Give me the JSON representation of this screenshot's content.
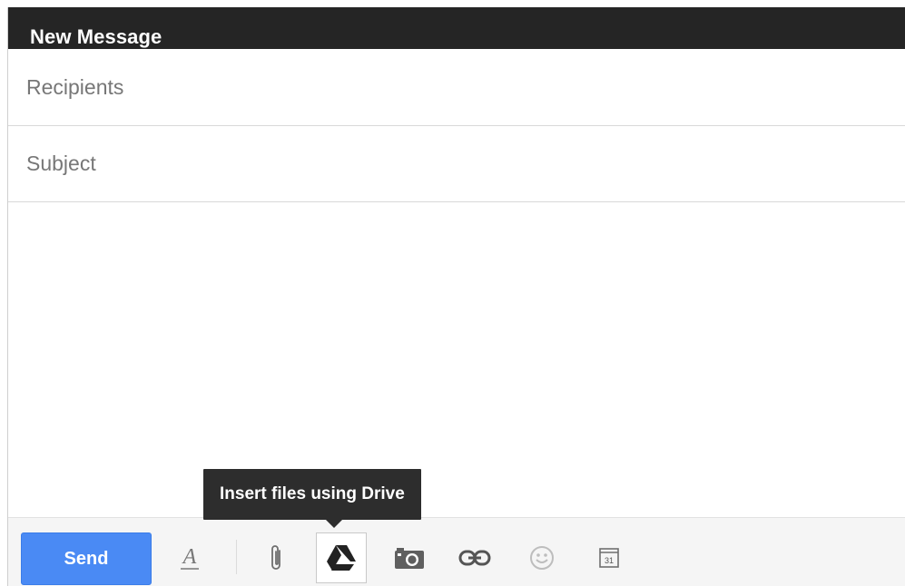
{
  "window": {
    "title": "New Message"
  },
  "fields": {
    "recipients_placeholder": "Recipients",
    "recipients_value": "",
    "subject_placeholder": "Subject",
    "subject_value": "",
    "body_text": ""
  },
  "toolbar": {
    "send_label": "Send",
    "tools": [
      {
        "icon": "formatting-options-icon"
      },
      {
        "icon": "attach-files-icon"
      },
      {
        "icon": "google-drive-icon"
      },
      {
        "icon": "insert-photo-icon"
      },
      {
        "icon": "insert-link-icon"
      },
      {
        "icon": "insert-emoticon-icon"
      },
      {
        "icon": "calendar-invite-icon"
      }
    ],
    "calendar_day": "31"
  },
  "tooltip": {
    "text": "Insert files using Drive"
  },
  "colors": {
    "titlebar": "#252525",
    "send_button": "#4a8af4",
    "footer": "#f5f5f5",
    "tooltip": "#2d2d2d"
  }
}
